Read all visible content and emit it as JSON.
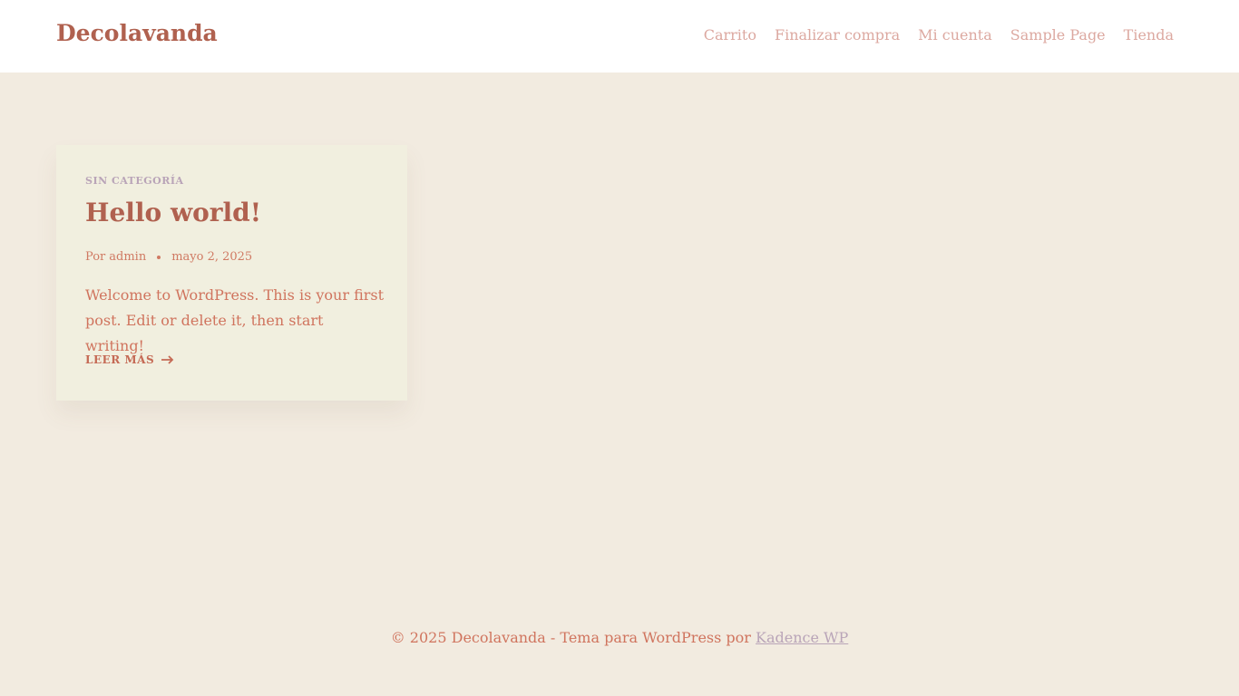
{
  "header": {
    "site_title": "Decolavanda",
    "nav": [
      "Carrito",
      "Finalizar compra",
      "Mi cuenta",
      "Sample Page",
      "Tienda"
    ]
  },
  "post": {
    "category": "SIN CATEGORÍA",
    "title": "Hello world!",
    "author_prefix": "Por",
    "author": "admin",
    "date": "mayo 2, 2025",
    "excerpt": "Welcome to WordPress. This is your first post. Edit or delete it, then start writing!",
    "read_more": "LEER MÁS",
    "read_more_icon": "arrow-right-icon"
  },
  "footer": {
    "text": "© 2025 Decolavanda - Tema para WordPress por",
    "link": "Kadence WP"
  },
  "colors": {
    "background": "#f2ebe0",
    "header_bg": "#ffffff",
    "card_bg": "#f1efdf",
    "brand": "#b0614f",
    "text": "#d0745e",
    "nav": "#dca8a0",
    "accent": "#b9a4b8"
  }
}
